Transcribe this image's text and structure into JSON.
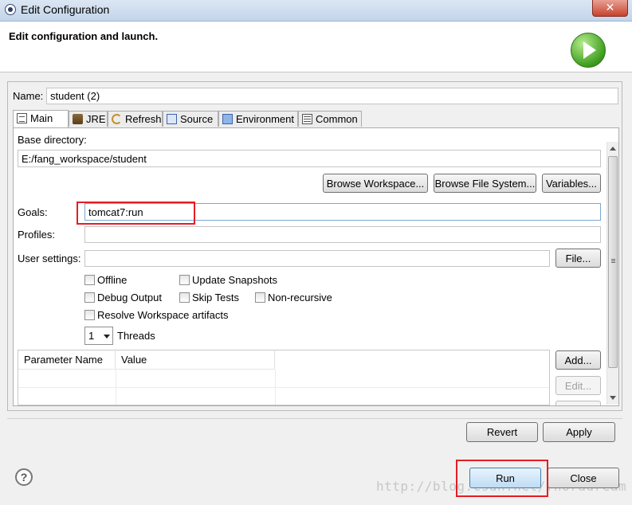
{
  "window": {
    "title": "Edit Configuration",
    "close_glyph": "✕"
  },
  "banner": {
    "heading": "Edit configuration and launch.",
    "icon": "run-icon"
  },
  "config": {
    "name_label": "Name:",
    "name_value": "student (2)"
  },
  "tabs": [
    {
      "label": "Main",
      "icon": "main-tab-icon",
      "active": true
    },
    {
      "label": "JRE",
      "icon": "jre-icon",
      "active": false
    },
    {
      "label": "Refresh",
      "icon": "refresh-icon",
      "active": false
    },
    {
      "label": "Source",
      "icon": "source-icon",
      "active": false
    },
    {
      "label": "Environment",
      "icon": "environment-icon",
      "active": false
    },
    {
      "label": "Common",
      "icon": "common-icon",
      "active": false
    }
  ],
  "main": {
    "base_dir_label": "Base directory:",
    "base_dir_value": "E:/fang_workspace/student",
    "browse_workspace": "Browse Workspace...",
    "browse_fs": "Browse File System...",
    "variables": "Variables...",
    "goals_label": "Goals:",
    "goals_value": "tomcat7:run",
    "profiles_label": "Profiles:",
    "profiles_value": "",
    "user_settings_label": "User settings:",
    "user_settings_value": "",
    "file_button": "File...",
    "checkboxes": {
      "offline": "Offline",
      "update_snapshots": "Update Snapshots",
      "debug_output": "Debug Output",
      "skip_tests": "Skip Tests",
      "non_recursive": "Non-recursive",
      "resolve_workspace": "Resolve Workspace artifacts"
    },
    "threads_value": "1",
    "threads_label": "Threads",
    "table": {
      "columns": [
        "Parameter Name",
        "Value"
      ]
    },
    "add_button": "Add...",
    "edit_button": "Edit..."
  },
  "footer": {
    "revert": "Revert",
    "apply": "Apply",
    "run": "Run",
    "close": "Close",
    "help_glyph": "?",
    "watermark": "http://blog.csdn.net/fhoradream"
  },
  "colors": {
    "highlight_box": "#e31e24"
  }
}
